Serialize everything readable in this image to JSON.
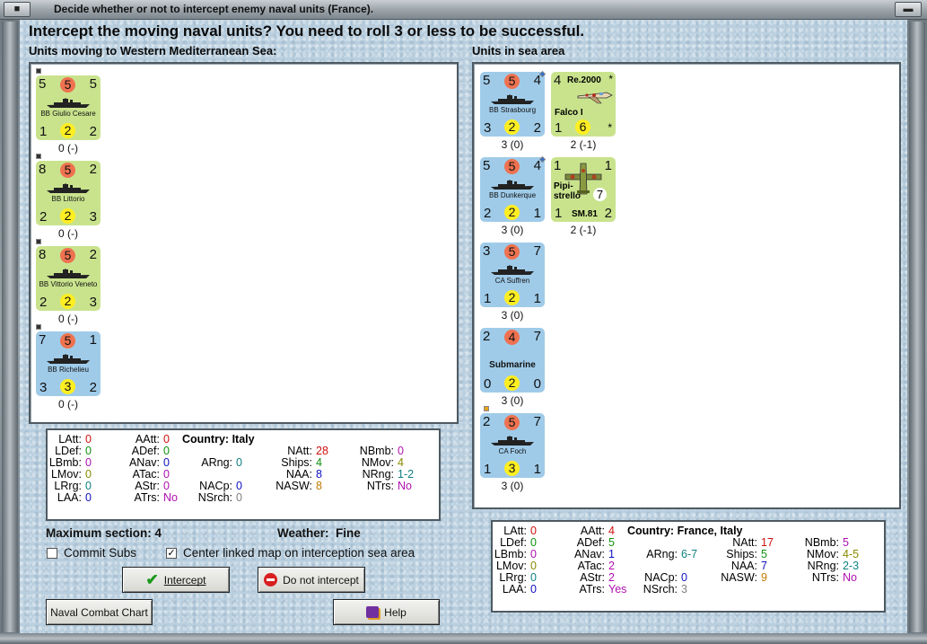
{
  "window": {
    "title": "Decide whether or not to intercept enemy naval units (France)."
  },
  "headline": "Intercept the moving naval units?  You need to roll 3 or less to be successful.",
  "moving_label": "Units moving to Western Mediterranean Sea:",
  "sea_label": "Units in sea area",
  "moving_units": [
    {
      "tl": "5",
      "top": "5",
      "tr": "5",
      "name": "BB Giulio Cesare",
      "bl": "1",
      "bot": "2",
      "br": "2",
      "caption": "0 (-)",
      "side": "italy"
    },
    {
      "tl": "8",
      "top": "5",
      "tr": "2",
      "name": "BB Littorio",
      "bl": "2",
      "bot": "2",
      "br": "3",
      "caption": "0 (-)",
      "side": "italy"
    },
    {
      "tl": "8",
      "top": "5",
      "tr": "2",
      "name": "BB Vittorio Veneto",
      "bl": "2",
      "bot": "2",
      "br": "3",
      "caption": "0 (-)",
      "side": "italy"
    },
    {
      "tl": "7",
      "top": "5",
      "tr": "1",
      "name": "BB Richelieu",
      "bl": "3",
      "bot": "3",
      "br": "2",
      "caption": "0 (-)",
      "side": "france"
    }
  ],
  "sea_units": [
    {
      "tl": "5",
      "top": "5",
      "tr": "4",
      "name": "BB Strasbourg",
      "bl": "3",
      "bot": "2",
      "br": "2",
      "caption": "3 (0)"
    },
    {
      "tl": "5",
      "top": "5",
      "tr": "4",
      "name": "BB Dunkerque",
      "bl": "2",
      "bot": "2",
      "br": "1",
      "caption": "3 (0)"
    },
    {
      "tl": "3",
      "top": "5",
      "tr": "7",
      "name": "CA Suffren",
      "bl": "1",
      "bot": "2",
      "br": "1",
      "caption": "3 (0)"
    },
    {
      "tl": "2",
      "top": "4",
      "tr": "7",
      "name": "Submarine",
      "bl": "0",
      "bot": "2",
      "br": "0",
      "caption": "3 (0)"
    },
    {
      "tl": "2",
      "top": "5",
      "tr": "7",
      "name": "CA Foch",
      "bl": "1",
      "bot": "3",
      "br": "1",
      "caption": "3 (0)"
    }
  ],
  "air_units": [
    {
      "tl": "4",
      "model": "Re.2000",
      "star": "*",
      "name": "Falco I",
      "bl": "1",
      "bot": "6",
      "br": "*",
      "caption": "2 (-1)"
    },
    {
      "tl": "1",
      "tr": "1",
      "name": "Pipi-strello",
      "badge": "7",
      "bl": "1",
      "model": "SM.81",
      "br": "2",
      "caption": "2 (-1)"
    }
  ],
  "italy_stats": {
    "country_label": "Country:",
    "country": "Italy",
    "LAtt": "0",
    "LDef": "0",
    "LBmb": "0",
    "LMov": "0",
    "LRrg": "0",
    "LAA": "0",
    "AAtt": "0",
    "ADef": "0",
    "ANav": "0",
    "ATac": "0",
    "AStr": "0",
    "ATrs": "No",
    "ARng": "0",
    "NACp": "0",
    "NSrch": "0",
    "NAtt": "28",
    "Ships": "4",
    "NAA": "8",
    "NASW": "8",
    "NBmb": "0",
    "NMov": "4",
    "NRng": "1-2",
    "NTrs": "No"
  },
  "france_stats": {
    "country_label": "Country:",
    "country": "France, Italy",
    "LAtt": "0",
    "LDef": "0",
    "LBmb": "0",
    "LMov": "0",
    "LRrg": "0",
    "LAA": "0",
    "AAtt": "4",
    "ADef": "5",
    "ANav": "1",
    "ATac": "2",
    "AStr": "2",
    "ATrs": "Yes",
    "ARng": "6-7",
    "NACp": "0",
    "NSrch": "3",
    "NAtt": "17",
    "Ships": "5",
    "NAA": "7",
    "NASW": "9",
    "NBmb": "5",
    "NMov": "4-5",
    "NRng": "2-3",
    "NTrs": "No"
  },
  "controls": {
    "max_section_label": "Maximum section:",
    "max_section": "4",
    "weather_label": "Weather:",
    "weather": "Fine",
    "commit_subs": "Commit Subs",
    "center_map": "Center linked map on interception sea area",
    "intercept": "Intercept",
    "do_not_intercept": "Do not intercept",
    "naval_chart": "Naval Combat Chart",
    "help": "Help"
  }
}
